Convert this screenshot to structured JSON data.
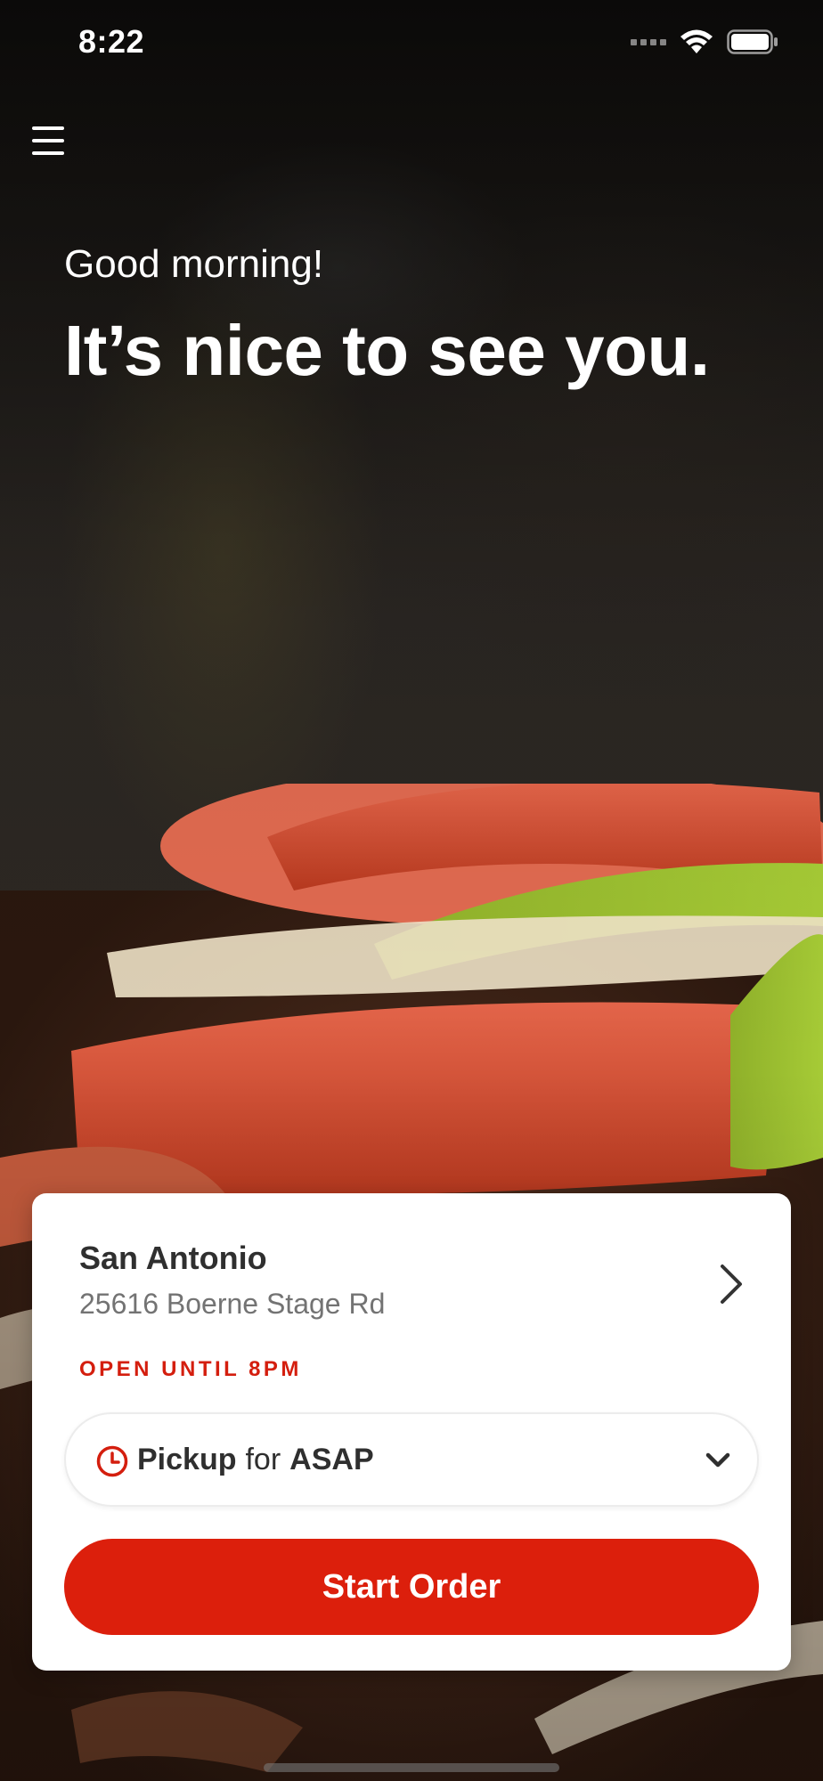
{
  "status_bar": {
    "time": "8:22"
  },
  "icons": {
    "menu": "hamburger-menu-icon",
    "wifi": "wifi-icon",
    "battery": "battery-icon",
    "signal": "signal-icon",
    "location_chevron": "chevron-right-icon",
    "clock": "clock-icon",
    "dropdown": "chevron-down-icon"
  },
  "hero": {
    "greeting": "Good morning!",
    "headline": "It’s nice to see you."
  },
  "location": {
    "name": "San Antonio",
    "address": "25616 Boerne Stage Rd",
    "hours_status": "OPEN UNTIL 8PM"
  },
  "order_mode": {
    "mode": "Pickup",
    "connector": "for",
    "time": "ASAP"
  },
  "actions": {
    "start_order": "Start Order"
  },
  "colors": {
    "accent": "#dc1f0c",
    "status_red": "#d41e0e",
    "text_dark": "#2f2f2f",
    "text_muted": "#737373"
  }
}
